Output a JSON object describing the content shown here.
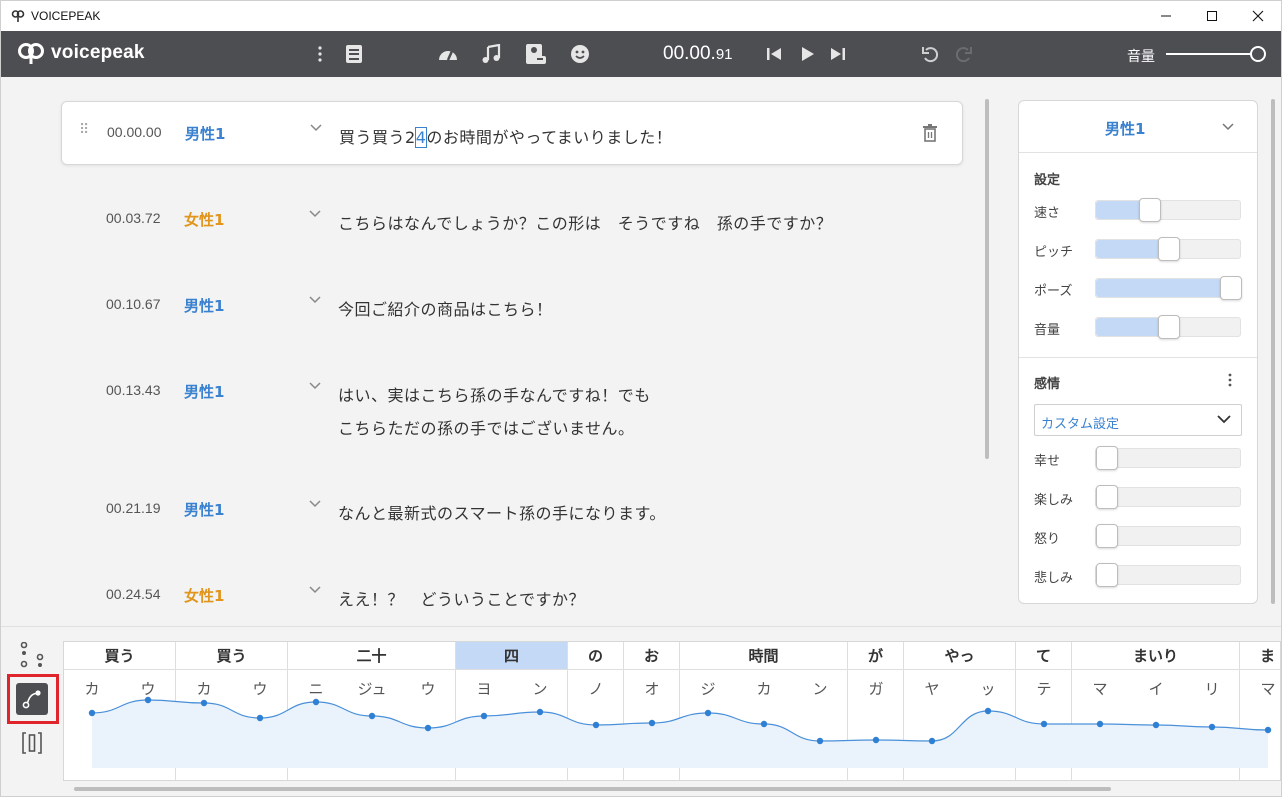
{
  "window": {
    "title": "VOICEPEAK"
  },
  "toolbar": {
    "brand": "voicepeak",
    "timecode_main": "00.00.",
    "timecode_frac": "91",
    "volume_label": "音量",
    "volume_level": 1.0
  },
  "rows": [
    {
      "time": "00.00.00",
      "speaker": "男性1",
      "speaker_color": "#3a82d0",
      "text_before": "買う買う2",
      "text_caret": "4",
      "text_after": "のお時間がやってまいりました！",
      "selected": true
    },
    {
      "time": "00.03.72",
      "speaker": "女性1",
      "speaker_color": "#e0951c",
      "line1": "こちらはなんでしょうか？この形は　そうですね　孫の手ですか？"
    },
    {
      "time": "00.10.67",
      "speaker": "男性1",
      "speaker_color": "#3a82d0",
      "line1": "今回ご紹介の商品はこちら！"
    },
    {
      "time": "00.13.43",
      "speaker": "男性1",
      "speaker_color": "#3a82d0",
      "line1": "はい、実はこちら孫の手なんですね！でも",
      "line2": "こちらただの孫の手ではございません。"
    },
    {
      "time": "00.21.19",
      "speaker": "男性1",
      "speaker_color": "#3a82d0",
      "line1": "なんと最新式のスマート孫の手になります。"
    },
    {
      "time": "00.24.54",
      "speaker": "女性1",
      "speaker_color": "#e0951c",
      "line1": "ええ！？　どういうことですか？"
    }
  ],
  "panel": {
    "narrator": "男性1",
    "settings_heading": "設定",
    "settings": [
      {
        "label": "速さ",
        "value": 0.35
      },
      {
        "label": "ピッチ",
        "value": 0.5
      },
      {
        "label": "ポーズ",
        "value": 1.0
      },
      {
        "label": "音量",
        "value": 0.5
      }
    ],
    "emotion_heading": "感情",
    "emotion_preset": "カスタム設定",
    "emotions": [
      {
        "label": "幸せ",
        "value": 0
      },
      {
        "label": "楽しみ",
        "value": 0
      },
      {
        "label": "怒り",
        "value": 0
      },
      {
        "label": "悲しみ",
        "value": 0
      }
    ]
  },
  "editor": {
    "words": [
      {
        "word": "買う",
        "kana": [
          "カ",
          "ウ"
        ]
      },
      {
        "word": "買う",
        "kana": [
          "カ",
          "ウ"
        ]
      },
      {
        "word": "二十",
        "kana": [
          "ニ",
          "ジュ",
          "ウ"
        ]
      },
      {
        "word": "四",
        "kana": [
          "ヨ",
          "ン"
        ],
        "highlight": true
      },
      {
        "word": "の",
        "kana": [
          "ノ"
        ]
      },
      {
        "word": "お",
        "kana": [
          "オ"
        ]
      },
      {
        "word": "時間",
        "kana": [
          "ジ",
          "カ",
          "ン"
        ]
      },
      {
        "word": "が",
        "kana": [
          "ガ"
        ]
      },
      {
        "word": "やっ",
        "kana": [
          "ヤ",
          "ッ"
        ]
      },
      {
        "word": "て",
        "kana": [
          "テ"
        ]
      },
      {
        "word": "まいり",
        "kana": [
          "マ",
          "イ",
          "リ"
        ]
      },
      {
        "word": "ま",
        "kana": [
          "マ"
        ]
      }
    ],
    "pitch": [
      0.45,
      0.58,
      0.55,
      0.4,
      0.56,
      0.42,
      0.3,
      0.42,
      0.46,
      0.33,
      0.35,
      0.45,
      0.34,
      0.17,
      0.18,
      0.17,
      0.47,
      0.34,
      0.34,
      0.33,
      0.31,
      0.28
    ]
  }
}
